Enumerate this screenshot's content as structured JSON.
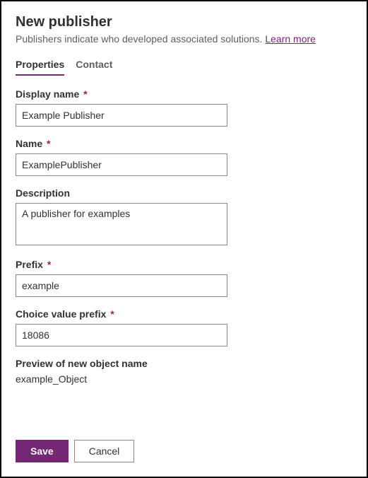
{
  "header": {
    "title": "New publisher",
    "subtitle_prefix": "Publishers indicate who developed associated solutions. ",
    "learn_more": "Learn more"
  },
  "tabs": {
    "properties": "Properties",
    "contact": "Contact"
  },
  "fields": {
    "display_name": {
      "label": "Display name",
      "value": "Example Publisher"
    },
    "name": {
      "label": "Name",
      "value": "ExamplePublisher"
    },
    "description": {
      "label": "Description",
      "value": "A publisher for examples"
    },
    "prefix": {
      "label": "Prefix",
      "value": "example"
    },
    "choice_value_prefix": {
      "label": "Choice value prefix",
      "value": "18086"
    },
    "preview": {
      "label": "Preview of new object name",
      "value": "example_Object"
    }
  },
  "required_marker": "*",
  "footer": {
    "save": "Save",
    "cancel": "Cancel"
  }
}
